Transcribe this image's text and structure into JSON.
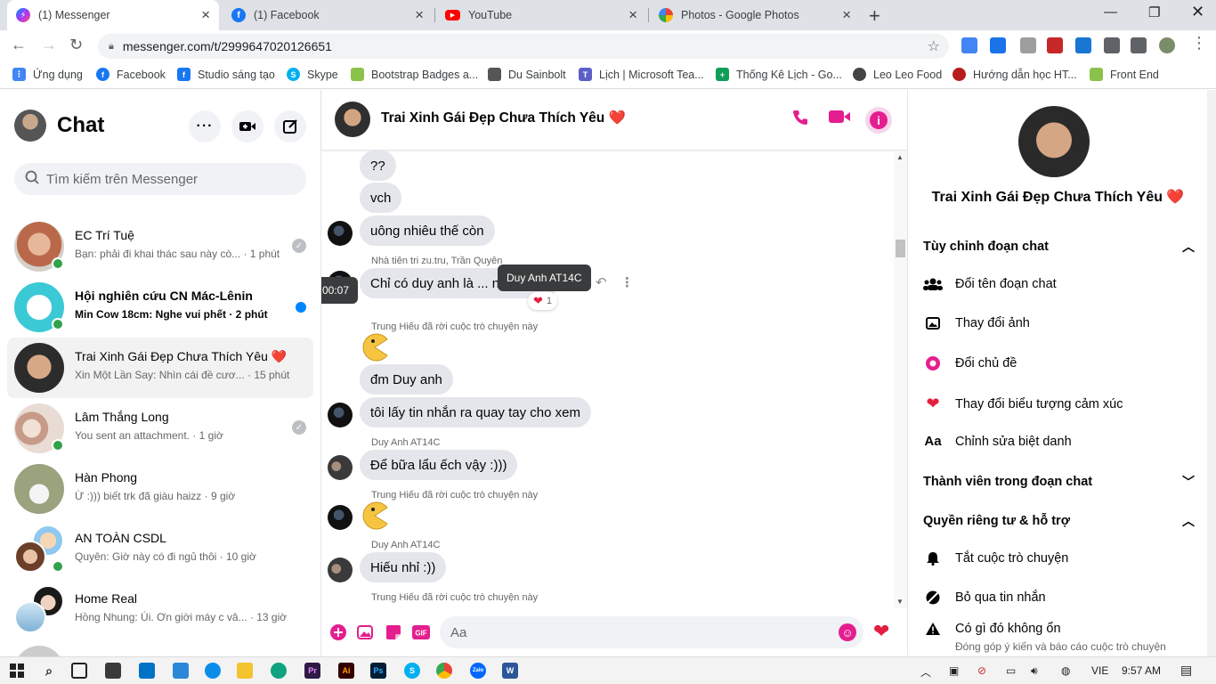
{
  "browser": {
    "tabs": [
      {
        "title": "(1) Messenger",
        "icon": "messenger-icon",
        "color": "#a334fa"
      },
      {
        "title": "(1) Facebook",
        "icon": "facebook-icon",
        "color": "#1877f2"
      },
      {
        "title": "YouTube",
        "icon": "youtube-icon",
        "color": "#ff0000"
      },
      {
        "title": "Photos - Google Photos",
        "icon": "google-photos-icon",
        "color": "#fbbc04"
      }
    ],
    "url": "messenger.com/t/2999647020126651",
    "bookmarks": [
      {
        "label": "Ứng dụng",
        "color": "#4285f4"
      },
      {
        "label": "Facebook",
        "color": "#1877f2"
      },
      {
        "label": "Studio sáng tạo",
        "color": "#1877f2"
      },
      {
        "label": "Skype",
        "color": "#00aff0"
      },
      {
        "label": "Bootstrap Badges a...",
        "color": "#8bc34a"
      },
      {
        "label": "Du Sainbolt",
        "color": "#555555"
      },
      {
        "label": "Lịch | Microsoft Tea...",
        "color": "#5b5fc7"
      },
      {
        "label": "Thống Kê Lịch - Go...",
        "color": "#0f9d58"
      },
      {
        "label": "Leo Leo Food",
        "color": "#444444"
      },
      {
        "label": "Hướng dẫn học HT...",
        "color": "#b71c1c"
      },
      {
        "label": "Front End",
        "color": "#8bc34a"
      }
    ]
  },
  "sidebar": {
    "title": "Chat",
    "search_placeholder": "Tìm kiếm trên Messenger",
    "conversations": [
      {
        "name": "EC Trí Tuệ",
        "snippet": "Bạn: phải đi khai thác sau này cò... · 1 phút",
        "status": "seen"
      },
      {
        "name": "Hội nghiên cứu CN Mác-Lênin",
        "snippet": "Min Cow 18cm: Nghe vui phết · 2 phút",
        "status": "unread"
      },
      {
        "name": "Trai Xinh Gái Đẹp Chưa Thích Yêu ❤️",
        "snippet": "Xin Một Lần Say: Nhìn cái đề cươ... · 15 phút",
        "status": "none"
      },
      {
        "name": "Lâm Thắng Long",
        "snippet": "You sent an attachment. · 1 giờ",
        "status": "seen"
      },
      {
        "name": "Hàn Phong",
        "snippet": "Ừ :))) biết trk đã giàu haizz · 9 giờ",
        "status": "none"
      },
      {
        "name": "AN TOÀN CSDL",
        "snippet": "Quyên: Giờ này có đi ngủ thôi · 10 giờ",
        "status": "none"
      },
      {
        "name": "Home Real",
        "snippet": "Hồng Nhung: Úi. Ơn giời máy c vâ... · 13 giờ",
        "status": "none"
      }
    ]
  },
  "chat": {
    "title": "Trai Xinh Gái Đẹp Chưa Thích Yêu ❤️",
    "messages": {
      "m1": "??",
      "m2": "vch",
      "m3": "uông nhiêu thế còn",
      "reply_meta": "Nhà tiên tri zu.tru, Trần Quyên",
      "m4": "Chỉ có duy anh là ... nhất nhất",
      "time_tooltip": "00:07",
      "sender_tooltip": "Duy Anh AT14C",
      "reaction_count": "1",
      "sys1": "Trung Hiếu đã rời cuộc trò chuyện này",
      "m5": "đm Duy anh",
      "m6": "tôi lấy tin nhắn ra quay tay cho xem",
      "sender1": "Duy Anh AT14C",
      "m7": "Để bữa lẩu ếch vậy :)))",
      "sys2": "Trung Hiếu đã rời cuộc trò chuyện này",
      "sender2": "Duy Anh AT14C",
      "m8": "Hiếu nhỉ :))",
      "sys3": "Trung Hiếu đã rời cuộc trò chuyện này"
    },
    "composer_placeholder": "Aa"
  },
  "right_panel": {
    "name": "Trai Xinh Gái Đẹp Chưa Thích Yêu ❤️",
    "section_customize": "Tùy chỉnh đoạn chat",
    "rename": "Đổi tên đoạn chat",
    "change_photo": "Thay đổi ảnh",
    "change_theme": "Đổi chủ đề",
    "change_emoji": "Thay đổi biểu tượng cảm xúc",
    "edit_nicknames": "Chỉnh sửa biệt danh",
    "section_members": "Thành viên trong đoạn chat",
    "section_privacy": "Quyền riêng tư & hỗ trợ",
    "mute": "Tắt cuộc trò chuyện",
    "ignore": "Bỏ qua tin nhắn",
    "report": "Có gì đó không ổn",
    "report_sub": "Đóng góp ý kiến và báo cáo cuộc trò chuyện"
  },
  "taskbar": {
    "language": "VIE",
    "time": "9:57 AM"
  },
  "colors": {
    "accent": "#e41e8e",
    "online": "#31a24c",
    "unread": "#0084ff"
  }
}
